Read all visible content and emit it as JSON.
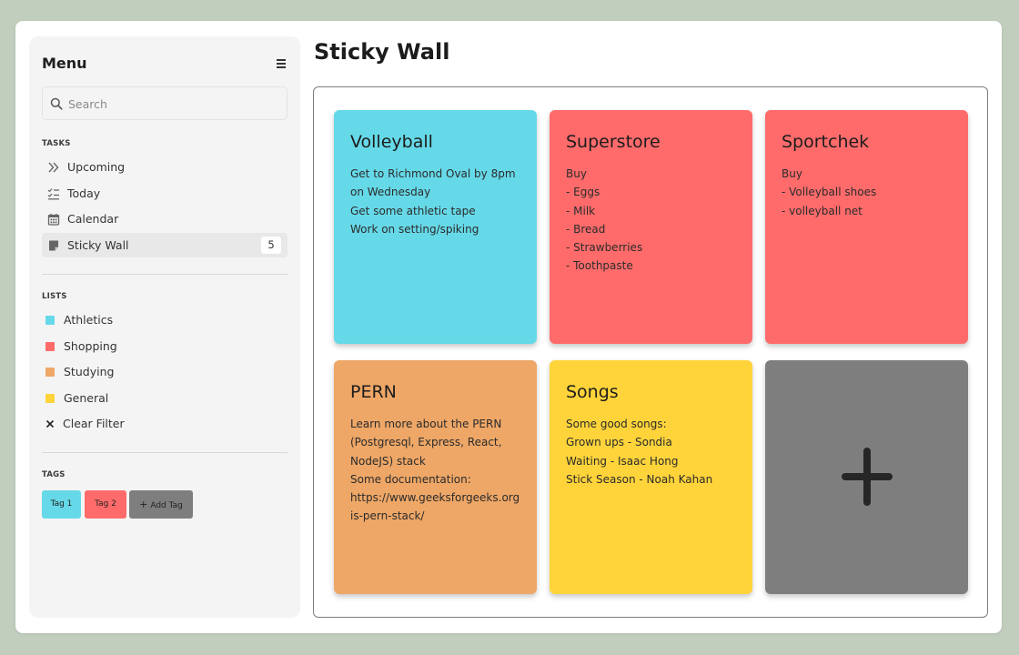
{
  "sidebar": {
    "menu_title": "Menu",
    "search_placeholder": "Search",
    "tasks_label": "TASKS",
    "tasks": [
      {
        "label": "Upcoming",
        "icon": "double-chevron-right-icon"
      },
      {
        "label": "Today",
        "icon": "checklist-icon"
      },
      {
        "label": "Calendar",
        "icon": "calendar-icon"
      },
      {
        "label": "Sticky Wall",
        "icon": "sticky-note-icon",
        "count": "5",
        "active": true
      }
    ],
    "lists_label": "LISTS",
    "lists": [
      {
        "label": "Athletics",
        "color": "#66d9e8"
      },
      {
        "label": "Shopping",
        "color": "#ff6b6b"
      },
      {
        "label": "Studying",
        "color": "#eea767"
      },
      {
        "label": "General",
        "color": "#ffd43b"
      }
    ],
    "clear_filter": "Clear Filter",
    "tags_label": "TAGS",
    "tags": [
      {
        "label": "Tag 1",
        "color": "#66d9e8"
      },
      {
        "label": "Tag 2",
        "color": "#ff6b6b"
      }
    ],
    "add_tag": {
      "label": "Add Tag",
      "color": "#7e7e7e"
    }
  },
  "main": {
    "title": "Sticky Wall",
    "notes": [
      {
        "title": "Volleyball",
        "color": "#66d9e8",
        "lines": [
          "Get to Richmond Oval by 8pm",
          "on Wednesday",
          "Get some athletic tape",
          "Work on setting/spiking"
        ]
      },
      {
        "title": "Superstore",
        "color": "#ff6b6b",
        "lines": [
          "Buy",
          "- Eggs",
          "- Milk",
          "- Bread",
          "- Strawberries",
          "- Toothpaste"
        ]
      },
      {
        "title": "Sportchek",
        "color": "#ff6b6b",
        "lines": [
          "Buy",
          "- Volleyball shoes",
          "- volleyball net"
        ]
      },
      {
        "title": "PERN",
        "color": "#eea767",
        "lines": [
          "Learn more about the PERN",
          "(Postgresql, Express, React,",
          "NodeJS) stack",
          "Some documentation:",
          "https://www.geeksforgeeks.org/",
          "is-pern-stack/"
        ]
      },
      {
        "title": "Songs",
        "color": "#ffd43b",
        "lines": [
          "Some good songs:",
          "Grown ups - Sondia",
          "Waiting - Isaac Hong",
          "Stick Season - Noah Kahan"
        ]
      }
    ],
    "add_note": {
      "icon": "plus-icon",
      "color": "#7e7e7e"
    }
  }
}
